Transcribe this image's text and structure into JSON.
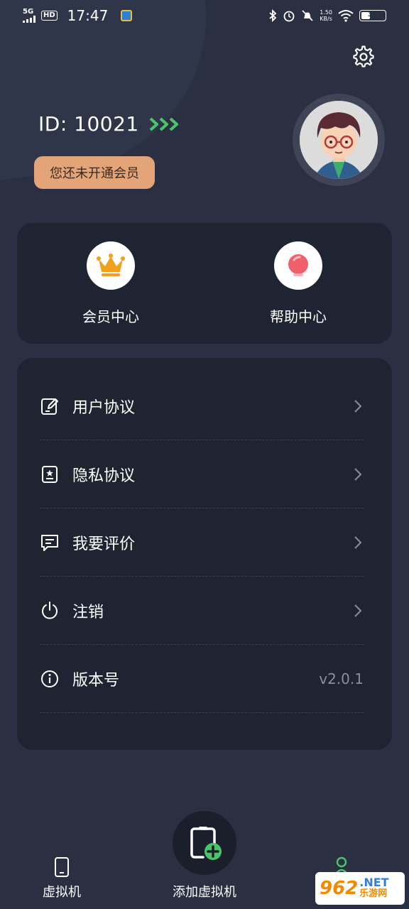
{
  "status_bar": {
    "signal_label": "5G",
    "hd_label": "HD",
    "time": "17:47",
    "net_speed": "1.50",
    "net_speed_unit": "KB/s",
    "battery": "38",
    "battery_level": 0.38
  },
  "profile": {
    "id_text": "ID:  10021",
    "vip_status": "您还未开通会员"
  },
  "quick_actions": [
    {
      "label": "会员中心",
      "icon": "crown-icon"
    },
    {
      "label": "帮助中心",
      "icon": "bulb-icon"
    }
  ],
  "menu": [
    {
      "label": "用户协议",
      "icon": "edit-doc-icon"
    },
    {
      "label": "隐私协议",
      "icon": "privacy-doc-icon"
    },
    {
      "label": "我要评价",
      "icon": "comment-icon"
    },
    {
      "label": "注销",
      "icon": "power-icon"
    },
    {
      "label": "版本号",
      "icon": "info-icon",
      "value": "v2.0.1"
    }
  ],
  "bottom_nav": {
    "left_label": "虚拟机",
    "center_label": "添加虚拟机"
  },
  "watermark": {
    "number": "962",
    "net": ".NET",
    "cn": "乐游网"
  },
  "colors": {
    "background": "#2a2f41",
    "card": "#1f2432",
    "vip_pill": "#e3a577",
    "accent_green": "#4cc36a",
    "crown": "#f3a11a",
    "bulb": "#f0606a"
  }
}
